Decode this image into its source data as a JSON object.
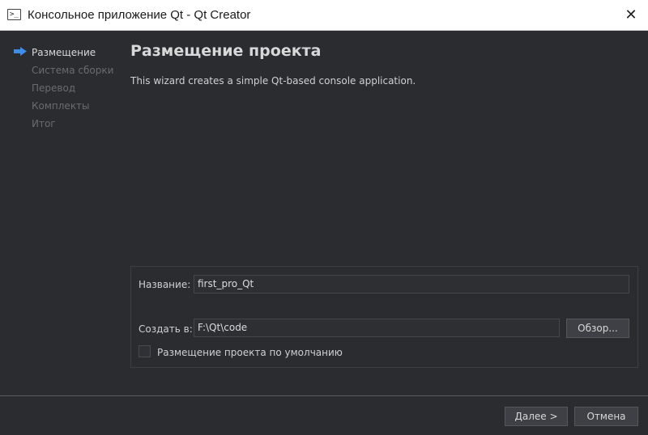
{
  "window": {
    "title": "Консольное приложение Qt - Qt Creator",
    "close_label": "✕",
    "icon_label": ">_"
  },
  "nav": {
    "items": [
      {
        "label": "Размещение",
        "active": true
      },
      {
        "label": "Система сборки",
        "active": false
      },
      {
        "label": "Перевод",
        "active": false
      },
      {
        "label": "Комплекты",
        "active": false
      },
      {
        "label": "Итог",
        "active": false
      }
    ]
  },
  "page": {
    "title": "Размещение проекта",
    "description": "This wizard creates a simple Qt-based console application."
  },
  "form": {
    "name_label": "Название:",
    "name_value": "first_pro_Qt",
    "location_label": "Создать в:",
    "location_value": "F:\\Qt\\code",
    "browse_label": "Обзор...",
    "default_location_label": "Размещение проекта по умолчанию",
    "default_location_checked": false
  },
  "buttons": {
    "next_label": "Далее >",
    "cancel_label": "Отмена"
  }
}
